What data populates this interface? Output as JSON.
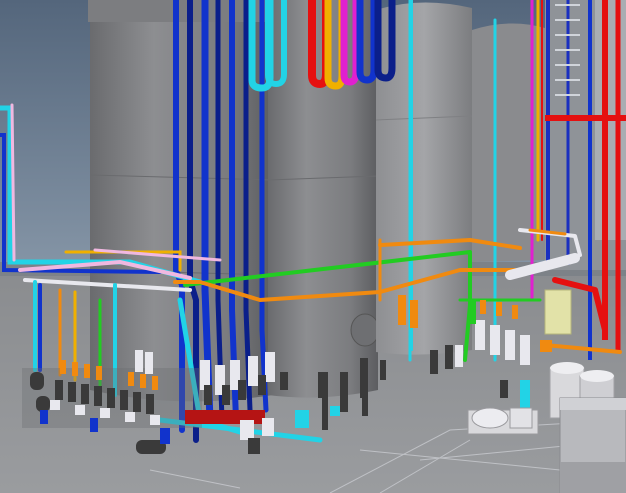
{
  "scene": {
    "description_tag": "",
    "colors": {
      "sky": "#5d6f83",
      "ground": "#8b8d90",
      "tank": "#7a7b7e",
      "tank_dark": "#5f6063",
      "tank_light": "#a2a3a6",
      "pipe_blue": "#1133cc",
      "pipe_navy": "#0b1f8a",
      "pipe_cyan": "#22d3e6",
      "pipe_green": "#22cc22",
      "pipe_orange": "#f08a10",
      "pipe_red": "#e51010",
      "pipe_yellow": "#f0b000",
      "pipe_magenta": "#e020d0",
      "pipe_pink": "#f0b8e0",
      "pipe_white": "#e8e8ee",
      "valve_dark": "#3a3a3a",
      "equipment_white": "#d9d9dc"
    }
  }
}
